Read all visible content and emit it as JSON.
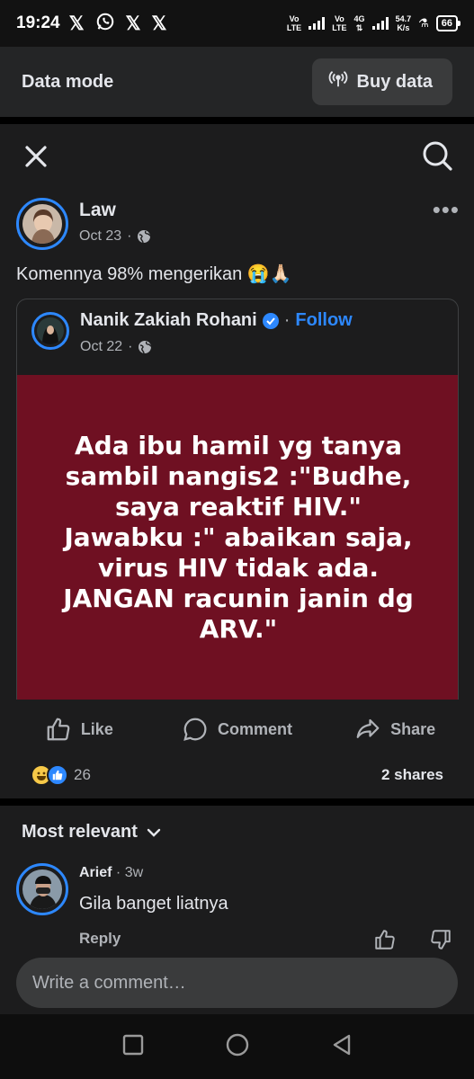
{
  "status_bar": {
    "time": "19:24",
    "notification_icons": [
      "x-icon",
      "whatsapp-icon",
      "x-icon",
      "x-icon"
    ],
    "sim1": "Vo\nLTE",
    "sim2": "Vo\nLTE",
    "network": "4G",
    "speed_value": "54.7",
    "speed_unit": "K/s",
    "battery": "66"
  },
  "data_mode": {
    "label": "Data mode",
    "buy_button": "Buy data"
  },
  "post": {
    "author": "Law",
    "date": "Oct 23",
    "text": "Komennya 98% mengerikan 😭🙏🏻",
    "shared": {
      "author": "Nanik Zakiah Rohani",
      "follow": "Follow",
      "date": "Oct 22",
      "background_color": "#6f1022",
      "quote": "Ada ibu hamil yg tanya\nsambil nangis2 :\"Budhe,\nsaya reaktif HIV.\"\nJawabku :\" abaikan saja,\nvirus HIV tidak ada.\nJANGAN racunin janin dg\nARV.\""
    },
    "actions": {
      "like": "Like",
      "comment": "Comment",
      "share": "Share"
    },
    "reaction_count": "26",
    "shares": "2 shares"
  },
  "comments": {
    "sort_label": "Most relevant",
    "items": [
      {
        "author": "Arief",
        "time": "3w",
        "text": "Gila banget liatnya",
        "reply": "Reply"
      }
    ]
  },
  "composer": {
    "placeholder": "Write a comment…"
  },
  "colors": {
    "accent": "#2d88ff",
    "background": "#1c1c1d"
  }
}
